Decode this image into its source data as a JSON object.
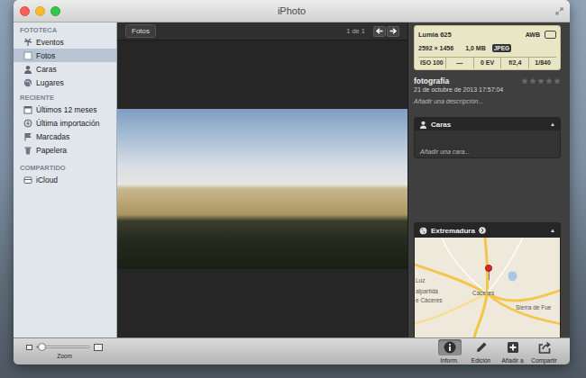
{
  "window": {
    "title": "iPhoto"
  },
  "sidebar": {
    "sections": [
      {
        "title": "FOTOTECA",
        "items": [
          {
            "label": "Eventos",
            "selected": false
          },
          {
            "label": "Fotos",
            "selected": true
          },
          {
            "label": "Caras",
            "selected": false
          },
          {
            "label": "Lugares",
            "selected": false
          }
        ]
      },
      {
        "title": "RECIENTE",
        "items": [
          {
            "label": "Últimos 12 meses",
            "selected": false
          },
          {
            "label": "Última importación",
            "selected": false
          },
          {
            "label": "Marcadas",
            "selected": false
          },
          {
            "label": "Papelera",
            "selected": false
          }
        ]
      },
      {
        "title": "COMPARTIDO",
        "items": [
          {
            "label": "iCloud",
            "selected": false
          }
        ]
      }
    ]
  },
  "viewer": {
    "back_button": "Fotos",
    "counter": "1 de 1"
  },
  "info": {
    "camera": {
      "model": "Lumia 625",
      "white_balance": "AWB",
      "dimensions": "2592 × 1456",
      "file_size": "1,0 MB",
      "format": "JPEG",
      "exposure": [
        "ISO 100",
        "—",
        "0 EV",
        "f/2,4",
        "1/840"
      ]
    },
    "title": "fotografía",
    "stars": 0,
    "date": "21 de octubre de 2013 17:57:04",
    "description_placeholder": "Añadir una descripción..."
  },
  "faces": {
    "title": "Caras",
    "toggle": "▲",
    "expanded": true,
    "placeholder": "Añadir una cara..."
  },
  "places": {
    "title": "Extremadura",
    "toggle": "▲",
    "expanded": true,
    "map_labels": [
      "Luz",
      "alpartida",
      "e Cáceres",
      "Cáceres",
      "Sierra de Fue"
    ]
  },
  "toolbar": {
    "zoom": {
      "label": "Zoom",
      "level": 0.08
    },
    "buttons": [
      {
        "label": "Inform.",
        "selected": true
      },
      {
        "label": "Edición",
        "selected": false
      },
      {
        "label": "Añadir a",
        "selected": false
      },
      {
        "label": "Compartir",
        "selected": false
      }
    ]
  }
}
